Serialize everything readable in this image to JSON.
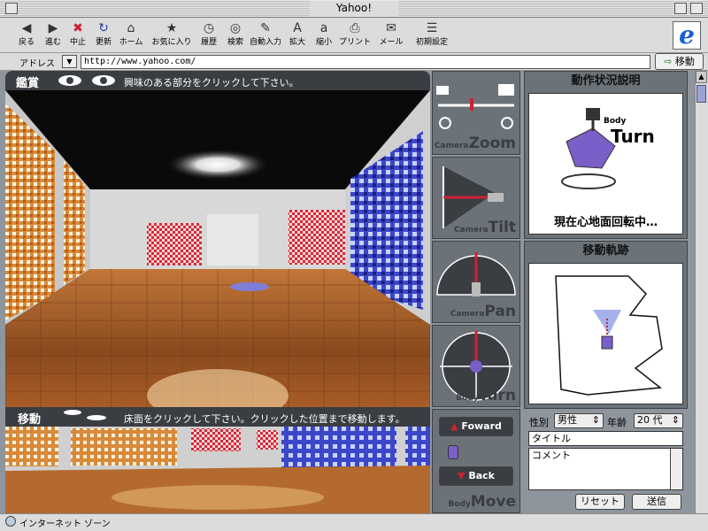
{
  "window": {
    "title": "Yahoo!"
  },
  "toolbar": {
    "buttons": [
      {
        "label": "戻る",
        "icon": "back-arrow-icon"
      },
      {
        "label": "進む",
        "icon": "forward-arrow-icon"
      },
      {
        "label": "中止",
        "icon": "stop-icon"
      },
      {
        "label": "更新",
        "icon": "refresh-icon"
      },
      {
        "label": "ホーム",
        "icon": "home-icon"
      },
      {
        "label": "お気に入り",
        "icon": "favorites-icon"
      },
      {
        "label": "履歴",
        "icon": "history-icon"
      },
      {
        "label": "検索",
        "icon": "search-icon"
      },
      {
        "label": "自動入力",
        "icon": "autofill-icon"
      },
      {
        "label": "拡大",
        "icon": "enlarge-text-icon"
      },
      {
        "label": "縮小",
        "icon": "shrink-text-icon"
      },
      {
        "label": "プリント",
        "icon": "print-icon"
      },
      {
        "label": "メール",
        "icon": "mail-icon"
      },
      {
        "label": "初期設定",
        "icon": "preferences-icon"
      }
    ]
  },
  "address": {
    "label": "アドレス",
    "url": "http://www.yahoo.com/",
    "go_label": "移動"
  },
  "viewer": {
    "title": "鑑賞",
    "message": "興味のある部分をクリックして下さい。"
  },
  "move": {
    "title": "移動",
    "message": "床面をクリックして下さい。クリックした位置まで移動します。"
  },
  "controls": {
    "zoom": {
      "prefix": "Camera",
      "label": "Zoom"
    },
    "tilt": {
      "prefix": "Camera",
      "label": "Tilt"
    },
    "pan": {
      "prefix": "Camera",
      "label": "Pan"
    },
    "turn": {
      "prefix": "Body",
      "label": "Turn"
    },
    "move": {
      "prefix": "Body",
      "label": "Move",
      "forward": "Foward",
      "back": "Back"
    }
  },
  "status_panel": {
    "title": "動作状況説明",
    "caption_prefix": "Body",
    "caption": "Turn",
    "text": "現在心地面回転中…"
  },
  "track_panel": {
    "title": "移動軌跡"
  },
  "form": {
    "gender_label": "性別",
    "gender_value": "男性",
    "age_label": "年齢",
    "age_value": "20 代",
    "title_field": "タイトル",
    "comment_field": "コメント",
    "reset": "リセット",
    "submit": "送信"
  },
  "status_bar": {
    "text": "インターネット ゾーン"
  },
  "colors": {
    "panel_dark": "#3a3d42",
    "panel_mid": "#6b7379",
    "accent_red": "#cc2233",
    "robot_purple": "#7a5fc8"
  }
}
